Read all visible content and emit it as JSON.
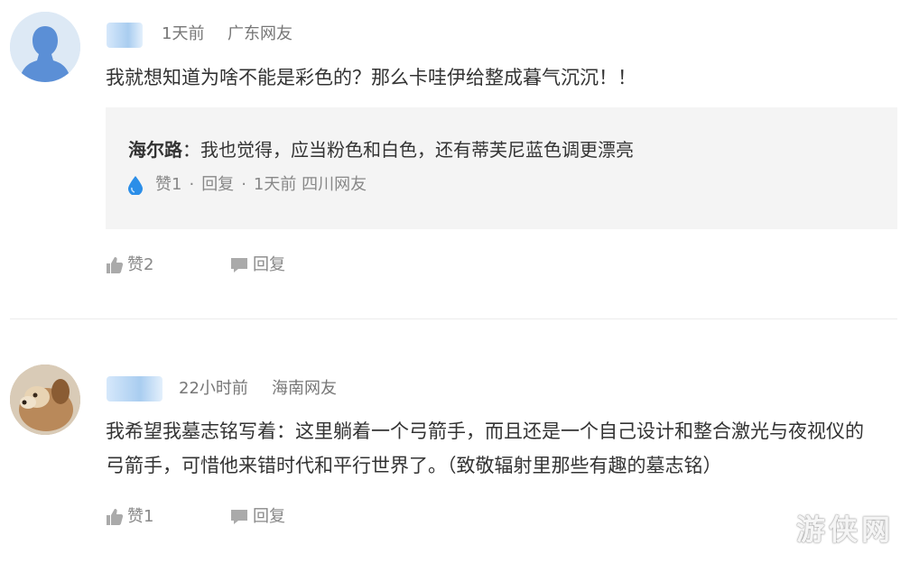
{
  "comments": [
    {
      "time": "1天前",
      "location": "广东网友",
      "text": "我就想知道为啥不能是彩色的？那么卡哇伊给整成暮气沉沉！！",
      "reply": {
        "name": "海尔路",
        "separator": "：",
        "text": "我也觉得，应当粉色和白色，还有蒂芙尼蓝色调更漂亮",
        "like_label": "赞1",
        "dot": "·",
        "reply_label": "回复",
        "time_location": "1天前 四川网友"
      },
      "like_label": "赞2",
      "reply_label": "回复"
    },
    {
      "time": "22小时前",
      "location": "海南网友",
      "text_line1": "我希望我墓志铭写着：这里躺着一个弓箭手，而且还是一个自己设计和整合激光与夜视仪的",
      "text_line2": "弓箭手，可惜他来错时代和平行世界了。（致敬辐射里那些有趣的墓志铭）",
      "like_label": "赞1",
      "reply_label": "回复"
    }
  ],
  "watermark": "游侠网",
  "colors": {
    "reply_bg": "#f4f4f4",
    "meta": "#777777",
    "text": "#333333",
    "drop": "#2b8ee8"
  }
}
